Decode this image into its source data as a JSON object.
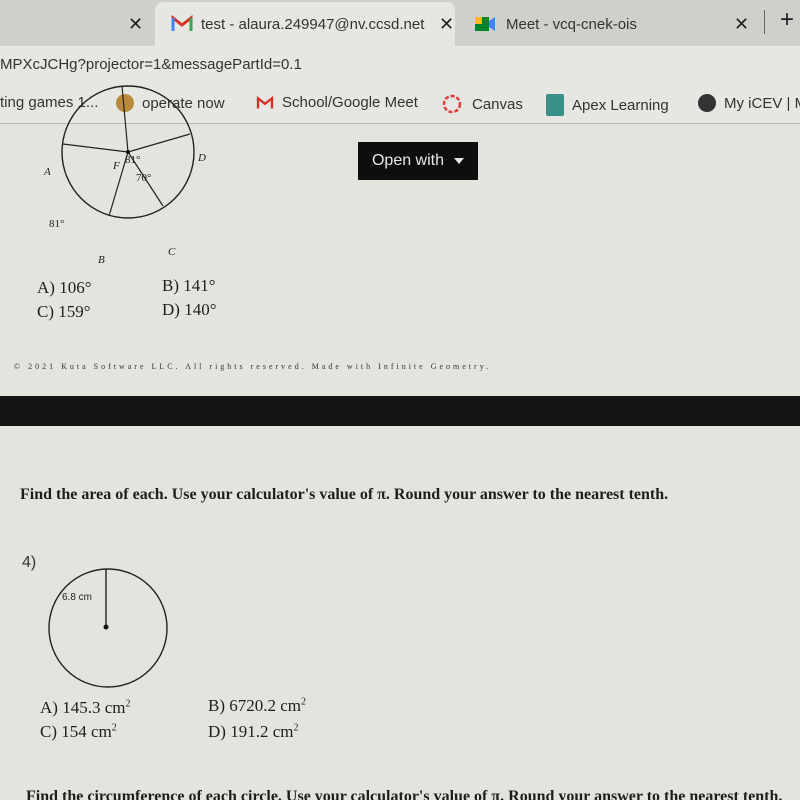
{
  "browser": {
    "tabs": [
      {
        "title": "",
        "active": false
      },
      {
        "title": "test - alaura.249947@nv.ccsd.net",
        "icon": "gmail-icon",
        "active": true
      },
      {
        "title": "Meet - vcq-cnek-ois",
        "icon": "google-meet-icon",
        "active": false
      }
    ],
    "close_glyph": "✕",
    "new_tab_glyph": "+",
    "url": "MPXcJCHg?projector=1&messagePartId=0.1",
    "bookmarks": [
      {
        "label": "ting games 1...",
        "icon": "none"
      },
      {
        "label": "operate now",
        "icon": "avatar-icon"
      },
      {
        "label": "School/Google Meet",
        "icon": "gmail-icon"
      },
      {
        "label": "Canvas",
        "icon": "canvas-icon"
      },
      {
        "label": "Apex Learning",
        "icon": "apex-icon"
      },
      {
        "label": "My iCEV | M",
        "icon": "globe-icon"
      }
    ]
  },
  "viewer": {
    "open_with_label": "Open with"
  },
  "page1": {
    "figure": {
      "points": [
        "A",
        "B",
        "C",
        "D",
        "F"
      ],
      "angles": [
        "81°",
        "70°",
        "81°"
      ]
    },
    "choices": [
      {
        "label": "A) 106°"
      },
      {
        "label": "B) 141°"
      },
      {
        "label": "C) 159°"
      },
      {
        "label": "D) 140°"
      }
    ],
    "copyright": "© 2021 Kuta Software LLC. All rights reserved. Made with Infinite Geometry."
  },
  "page2": {
    "instruction": "Find the area of each. Use your calculator's value of π. Round your answer to the nearest tenth.",
    "question_number": "4)",
    "radius_label": "6.8 cm",
    "choices": [
      {
        "label": "A) 145.3 cm",
        "unit_sup": "2"
      },
      {
        "label": "B) 6720.2 cm",
        "unit_sup": "2"
      },
      {
        "label": "C) 154 cm",
        "unit_sup": "2"
      },
      {
        "label": "D) 191.2 cm",
        "unit_sup": "2"
      }
    ],
    "next_instruction": "Find the circumference of each circle. Use your calculator's value of π. Round your answer to the nearest tenth."
  }
}
